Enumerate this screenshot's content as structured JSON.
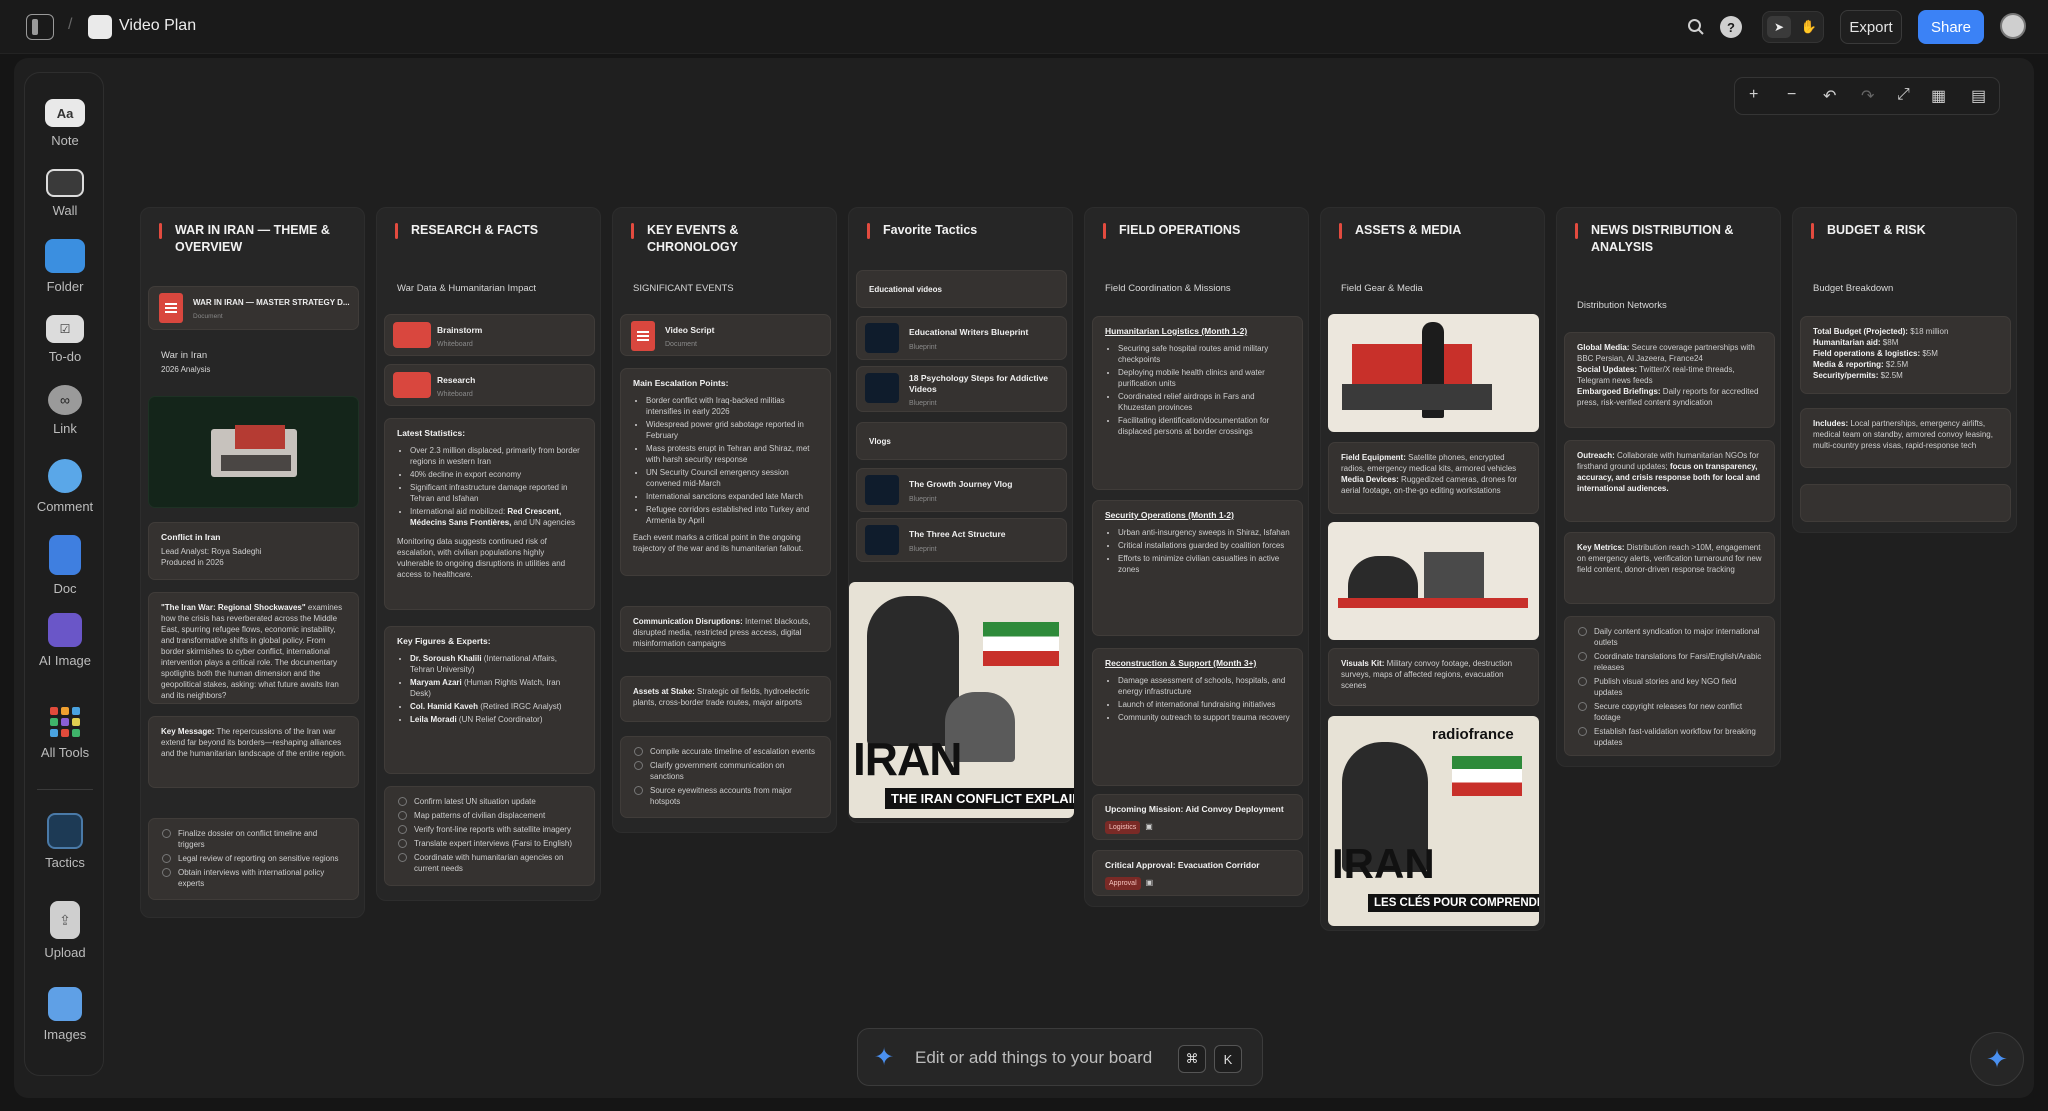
{
  "app": {
    "title": "Video Plan",
    "breadcrumb_sep": "/"
  },
  "topbar": {
    "export": "Export",
    "share": "Share"
  },
  "tools": [
    {
      "label": "Note",
      "icon": "note-icon",
      "glyph": "Aa"
    },
    {
      "label": "Wall",
      "icon": "wall-icon",
      "glyph": ""
    },
    {
      "label": "Folder",
      "icon": "folder-icon",
      "glyph": ""
    },
    {
      "label": "To-do",
      "icon": "todo-icon",
      "glyph": ""
    },
    {
      "label": "Link",
      "icon": "link-icon",
      "glyph": ""
    },
    {
      "label": "Comment",
      "icon": "comment-icon",
      "glyph": ""
    },
    {
      "label": "Doc",
      "icon": "doc-icon",
      "glyph": ""
    },
    {
      "label": "AI Image",
      "icon": "ai-image-icon",
      "glyph": ""
    },
    {
      "label": "All Tools",
      "icon": "all-tools-icon",
      "glyph": ""
    },
    {
      "label": "Tactics",
      "icon": "tactics-icon",
      "glyph": ""
    },
    {
      "label": "Upload",
      "icon": "upload-icon",
      "glyph": ""
    },
    {
      "label": "Images",
      "icon": "images-icon",
      "glyph": ""
    }
  ],
  "col1": {
    "title": "WAR IN IRAN — THEME & OVERVIEW",
    "doc_title": "WAR IN IRAN — MASTER STRATEGY D...",
    "doc_type": "Document",
    "label1": "War in Iran",
    "label2": "2026 Analysis",
    "info_title": "Conflict in Iran",
    "info_line1": "Lead Analyst: Roya Sadeghi",
    "info_line2": "Produced in 2026",
    "quote_bold": "\"The Iran War: Regional Shockwaves\"",
    "quote_text": " examines how the crisis has reverberated across the Middle East, spurring refugee flows, economic instability, and transformative shifts in global policy. From border skirmishes to cyber conflict, international intervention plays a critical role. The documentary spotlights both the human dimension and the geopolitical stakes, asking: what future awaits Iran and its neighbors?",
    "key_bold": "Key Message:",
    "key_text": " The repercussions of the Iran war extend far beyond its borders—reshaping alliances and the humanitarian landscape of the entire region.",
    "todos": [
      "Finalize dossier on conflict timeline and triggers",
      "Legal review of reporting on sensitive regions",
      "Obtain interviews with international policy experts"
    ]
  },
  "col2": {
    "title": "RESEARCH & FACTS",
    "sub": "War Data & Humanitarian Impact",
    "wb1": "Brainstorm",
    "wb1_type": "Whiteboard",
    "wb2": "Research",
    "wb2_type": "Whiteboard",
    "stats_title": "Latest Statistics:",
    "stats": [
      "Over 2.3 million displaced, primarily from border regions in western Iran",
      "40% decline in export economy",
      "Significant infrastructure damage reported in Tehran and Isfahan"
    ],
    "aid_pre": "International aid mobilized: ",
    "aid_bold": "Red Crescent, Médecins Sans Frontières,",
    "aid_post": " and UN agencies",
    "monitor": "Monitoring data suggests continued risk of escalation, with civilian populations highly vulnerable to ongoing disruptions in utilities and access to healthcare.",
    "figures_title": "Key Figures & Experts:",
    "figures": [
      {
        "name": "Dr. Soroush Khalili",
        "role": " (International Affairs, Tehran University)"
      },
      {
        "name": "Maryam Azari",
        "role": " (Human Rights Watch, Iran Desk)"
      },
      {
        "name": "Col. Hamid Kaveh",
        "role": " (Retired IRGC Analyst)"
      },
      {
        "name": "Leila Moradi",
        "role": " (UN Relief Coordinator)"
      }
    ],
    "todos": [
      "Confirm latest UN situation update",
      "Map patterns of civilian displacement",
      "Verify front-line reports with satellite imagery",
      "Translate expert interviews (Farsi to English)",
      "Coordinate with humanitarian agencies on current needs"
    ]
  },
  "col3": {
    "title": "KEY EVENTS & CHRONOLOGY",
    "sub": "SIGNIFICANT EVENTS",
    "doc": "Video Script",
    "doc_type": "Document",
    "points_title": "Main Escalation Points:",
    "points": [
      "Border conflict with Iraq-backed militias intensifies in early 2026",
      "Widespread power grid sabotage reported in February",
      "Mass protests erupt in Tehran and Shiraz, met with harsh security response",
      "UN Security Council emergency session convened mid-March",
      "International sanctions expanded late March",
      "Refugee corridors established into Turkey and Armenia by April"
    ],
    "points_foot": "Each event marks a critical point in the ongoing trajectory of the war and its humanitarian fallout.",
    "comm_bold": "Communication Disruptions:",
    "comm_text": " Internet blackouts, disrupted media, restricted press access, digital misinformation campaigns",
    "assets_bold": "Assets at Stake:",
    "assets_text": " Strategic oil fields, hydroelectric plants, cross-border trade routes, major airports",
    "todos": [
      "Compile accurate timeline of escalation events",
      "Clarify government communication on sanctions",
      "Source eyewitness accounts from major hotspots"
    ]
  },
  "col4": {
    "title": "Favorite Tactics",
    "group1": "Educational videos",
    "bp1": "Educational Writers Blueprint",
    "bp2": "18 Psychology Steps for Addictive Videos",
    "bp_type": "Blueprint",
    "group2": "Vlogs",
    "bp3": "The Growth Journey Vlog",
    "bp4": "The Three Act Structure",
    "poster_big": "IRAN",
    "poster_sub": "THE IRAN CONFLICT EXPLAINED"
  },
  "col5": {
    "title": "FIELD OPERATIONS",
    "sub": "Field Coordination & Missions",
    "h1": "Humanitarian Logistics (Month 1-2)",
    "h1_items": [
      "Securing safe hospital routes amid military checkpoints",
      "Deploying mobile health clinics and water purification units",
      "Coordinated relief airdrops in Fars and Khuzestan provinces",
      "Facilitating identification/documentation for displaced persons at border crossings"
    ],
    "h2": "Security Operations (Month 1-2)",
    "h2_items": [
      "Urban anti-insurgency sweeps in Shiraz, Isfahan",
      "Critical installations guarded by coalition forces",
      "Efforts to minimize civilian casualties in active zones"
    ],
    "h3": "Reconstruction & Support (Month 3+)",
    "h3_items": [
      "Damage assessment of schools, hospitals, and energy infrastructure",
      "Launch of international fundraising initiatives",
      "Community outreach to support trauma recovery"
    ],
    "m1": "Upcoming Mission: Aid Convoy Deployment",
    "m1_tag": "Logistics",
    "m2": "Critical Approval: Evacuation Corridor",
    "m2_tag": "Approval"
  },
  "col6": {
    "title": "ASSETS & MEDIA",
    "sub": "Field Gear & Media",
    "eq_bold": "Field Equipment:",
    "eq_text": " Satellite phones, encrypted radios, emergency medical kits, armored vehicles",
    "md_bold": "Media Devices:",
    "md_text": " Ruggedized cameras, drones for aerial footage, on-the-go editing workstations",
    "vk_bold": "Visuals Kit:",
    "vk_text": " Military convoy footage, destruction surveys, maps of affected regions, evacuation scenes",
    "poster_brand": "radiofrance",
    "poster_big": "IRAN",
    "poster_sub": "LES CLÉS POUR COMPRENDRE"
  },
  "col7": {
    "title": "NEWS DISTRIBUTION & ANALYSIS",
    "sub": "Distribution Networks",
    "gm_bold": "Global Media:",
    "gm_text": " Secure coverage partnerships with BBC Persian, Al Jazeera, France24",
    "su_bold": "Social Updates:",
    "su_text": " Twitter/X real-time threads, Telegram news feeds",
    "eb_bold": "Embargoed Briefings:",
    "eb_text": " Daily reports for accredited press, risk-verified content syndication",
    "out_bold": "Outreach:",
    "out_text": " Collaborate with humanitarian NGOs for firsthand ground updates; ",
    "out_bold2": "focus on transparency, accuracy, and crisis response both for local and international audiences.",
    "km_bold": "Key Metrics:",
    "km_text": " Distribution reach >10M, engagement on emergency alerts, verification turnaround for new field content, donor-driven response tracking",
    "todos": [
      "Daily content syndication to major international outlets",
      "Coordinate translations for Farsi/English/Arabic releases",
      "Publish visual stories and key NGO field updates",
      "Secure copyright releases for new conflict footage",
      "Establish fast-validation workflow for breaking updates"
    ]
  },
  "col8": {
    "title": "BUDGET & RISK",
    "sub": "Budget Breakdown",
    "lines": [
      {
        "k": "Total Budget (Projected):",
        "v": " $18 million"
      },
      {
        "k": "Humanitarian aid:",
        "v": " $8M"
      },
      {
        "k": "Field operations & logistics:",
        "v": " $5M"
      },
      {
        "k": "Media & reporting:",
        "v": " $2.5M"
      },
      {
        "k": "Security/permits:",
        "v": " $2.5M"
      }
    ],
    "inc_bold": "Includes:",
    "inc_text": " Local partnerships, emergency airlifts, medical team on standby, armored convoy leasing, multi-country press visas, rapid-response tech"
  },
  "prompt": {
    "placeholder": "Edit or add things to your board",
    "k1": "⌘",
    "k2": "K"
  },
  "colors": {
    "accent": "#e34b3f",
    "share": "#3b82f6",
    "bg": "#1f1f1f"
  }
}
